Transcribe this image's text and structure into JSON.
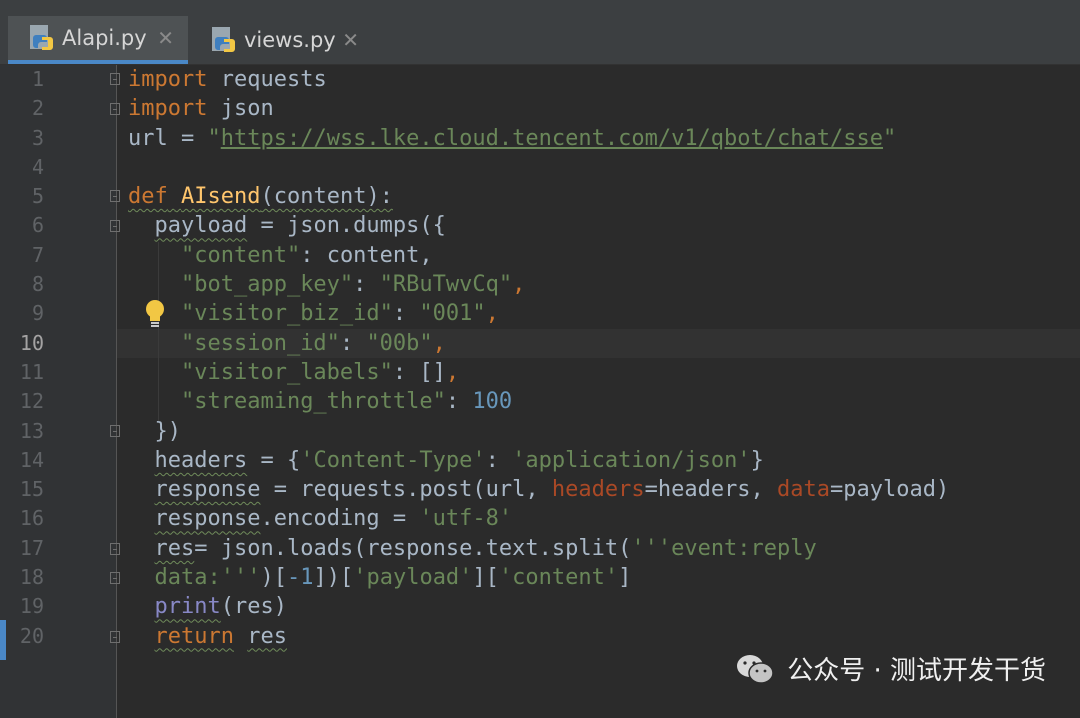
{
  "tabs": [
    {
      "label": "Alapi.py",
      "close": "✕",
      "active": true
    },
    {
      "label": "views.py",
      "close": "✕",
      "active": false
    }
  ],
  "current_line": 10,
  "line_numbers": [
    "1",
    "2",
    "3",
    "4",
    "5",
    "6",
    "7",
    "8",
    "9",
    "10",
    "11",
    "12",
    "13",
    "14",
    "15",
    "16",
    "17",
    "18",
    "19",
    "20"
  ],
  "code": {
    "l1": {
      "kw": "import",
      "rest": " requests"
    },
    "l2": {
      "kw": "import",
      "rest": " json"
    },
    "l3": {
      "a": "url = ",
      "q1": "\"",
      "url": "https://wss.lke.cloud.tencent.com/v1/qbot/chat/sse",
      "q2": "\""
    },
    "l5": {
      "kw": "def",
      "sp": " ",
      "fn": "AIsend",
      "rest": "(content):"
    },
    "l6": {
      "ind": "  ",
      "var": "payload",
      "rest": " = json.dumps({"
    },
    "l7": {
      "ind": "    ",
      "key": "\"content\"",
      "rest": ": content,"
    },
    "l8": {
      "ind": "    ",
      "key": "\"bot_app_key\"",
      "sep": ": ",
      "val": "\"RBuTwvCq\"",
      "comma": ","
    },
    "l9": {
      "ind": "    ",
      "key": "\"visitor_biz_id\"",
      "sep": ": ",
      "val": "\"001\"",
      "comma": ","
    },
    "l10": {
      "ind": "    ",
      "key": "\"session_id\"",
      "sep": ": ",
      "val": "\"00b\"",
      "comma": ","
    },
    "l11": {
      "ind": "    ",
      "key": "\"visitor_labels\"",
      "sep": ": ",
      "val": "[]",
      "comma": ","
    },
    "l12": {
      "ind": "    ",
      "key": "\"streaming_throttle\"",
      "sep": ": ",
      "val": "100"
    },
    "l13": {
      "ind": "  ",
      "rest": "})"
    },
    "l14": {
      "ind": "  ",
      "var": "headers",
      "a": " = {",
      "k": "'Content-Type'",
      "b": ": ",
      "v": "'application/json'",
      "c": "}"
    },
    "l15": {
      "ind": "  ",
      "var": "response",
      "a": " = requests.post(url, ",
      "p1": "headers",
      "b": "=headers, ",
      "p2": "data",
      "c": "=payload)"
    },
    "l16": {
      "ind": "  ",
      "var": "response",
      "a": ".encoding = ",
      "s": "'utf-8'"
    },
    "l17": {
      "ind": "  ",
      "var": "res",
      "a": "= json.loads(response.text.split(",
      "s": "'''event:reply"
    },
    "l18": {
      "ind": "  ",
      "s": "data:'''",
      "a": ")[",
      "n": "-1",
      "b": "])[",
      "s2": "'payload'",
      "c": "][",
      "s3": "'content'",
      "d": "]"
    },
    "l19": {
      "ind": "  ",
      "b": "print",
      "a": "(res)"
    },
    "l20": {
      "ind": "  ",
      "kw": "return",
      "sp": " ",
      "v": "res"
    }
  },
  "watermark": {
    "text": "公众号 · 测试开发干货"
  },
  "colors": {
    "background": "#2b2b2b",
    "keyword": "#cc7832",
    "string": "#6a8759",
    "number": "#6897bb",
    "function": "#ffc66d",
    "param": "#aa4926",
    "text": "#a9b7c6"
  }
}
